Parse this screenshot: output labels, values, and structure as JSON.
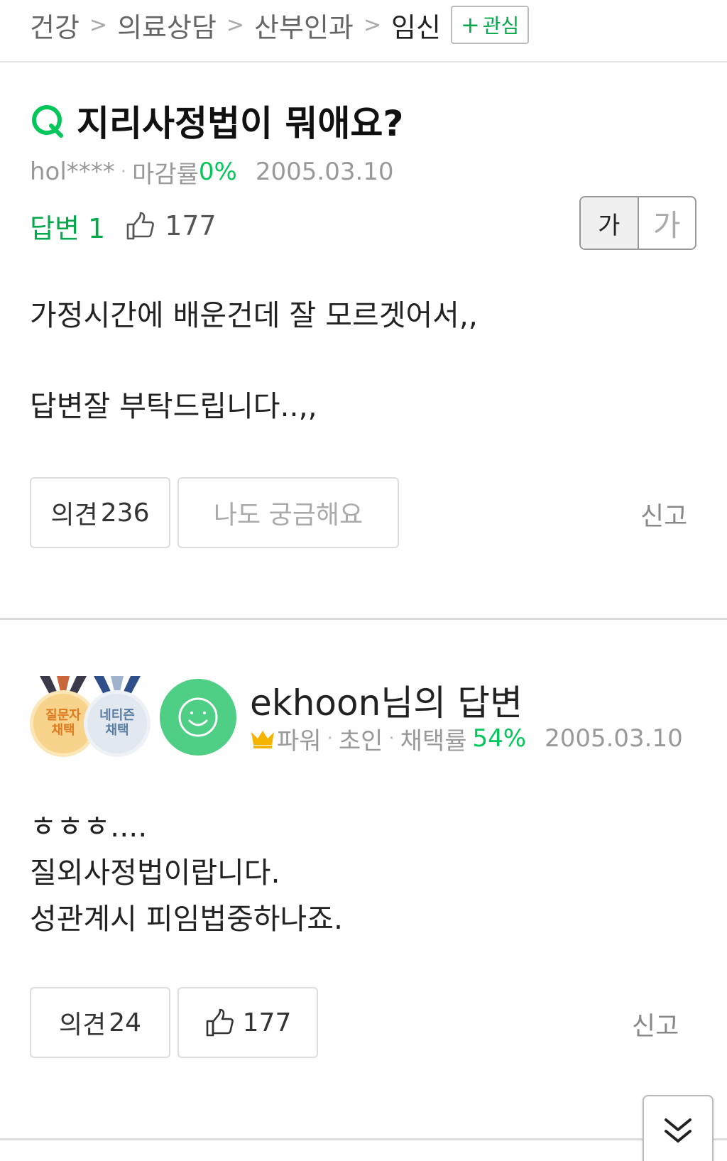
{
  "breadcrumb": {
    "items": [
      "건강",
      "의료상담",
      "산부인과",
      "임신"
    ],
    "separator": ">",
    "follow_label": "관심",
    "follow_plus": "+"
  },
  "question": {
    "title": "지리사정법이 뭐애요?",
    "author": "hol****",
    "close_rate_label": "마감률",
    "close_rate": "0%",
    "date": "2005.03.10",
    "answer_label": "답변",
    "answer_count": "1",
    "likes": "177",
    "body_lines": [
      "가정시간에 배운건데 잘 모르겟어서,,",
      "답변잘 부탁드립니다..,,"
    ],
    "opinion_label": "의견",
    "opinion_count": "236",
    "curious_label": "나도 궁금해요",
    "report_label": "신고"
  },
  "font_toggle": {
    "small": "가",
    "large": "가"
  },
  "answer": {
    "medal_asker": [
      "질문자",
      "채택"
    ],
    "medal_netizen": [
      "네티즌",
      "채택"
    ],
    "title": "ekhoon님의 답변",
    "rank": "파워",
    "level": "초인",
    "adopt_rate_label": "채택률",
    "adopt_rate": "54%",
    "date": "2005.03.10",
    "body_lines": [
      "ㅎㅎㅎ....",
      "질외사정법이랍니다.",
      "성관계시 피임법중하나죠."
    ],
    "opinion_label": "의견",
    "opinion_count": "24",
    "likes": "177",
    "report_label": "신고"
  },
  "colors": {
    "accent": "#03c75a",
    "avatar": "#4fcf85",
    "gold": "#f8d38b",
    "silver": "#e2e8ef"
  },
  "icons": [
    "question-q-icon",
    "thumbs-up-icon",
    "smiley-face-icon",
    "crown-icon",
    "double-chevron-down-icon"
  ]
}
